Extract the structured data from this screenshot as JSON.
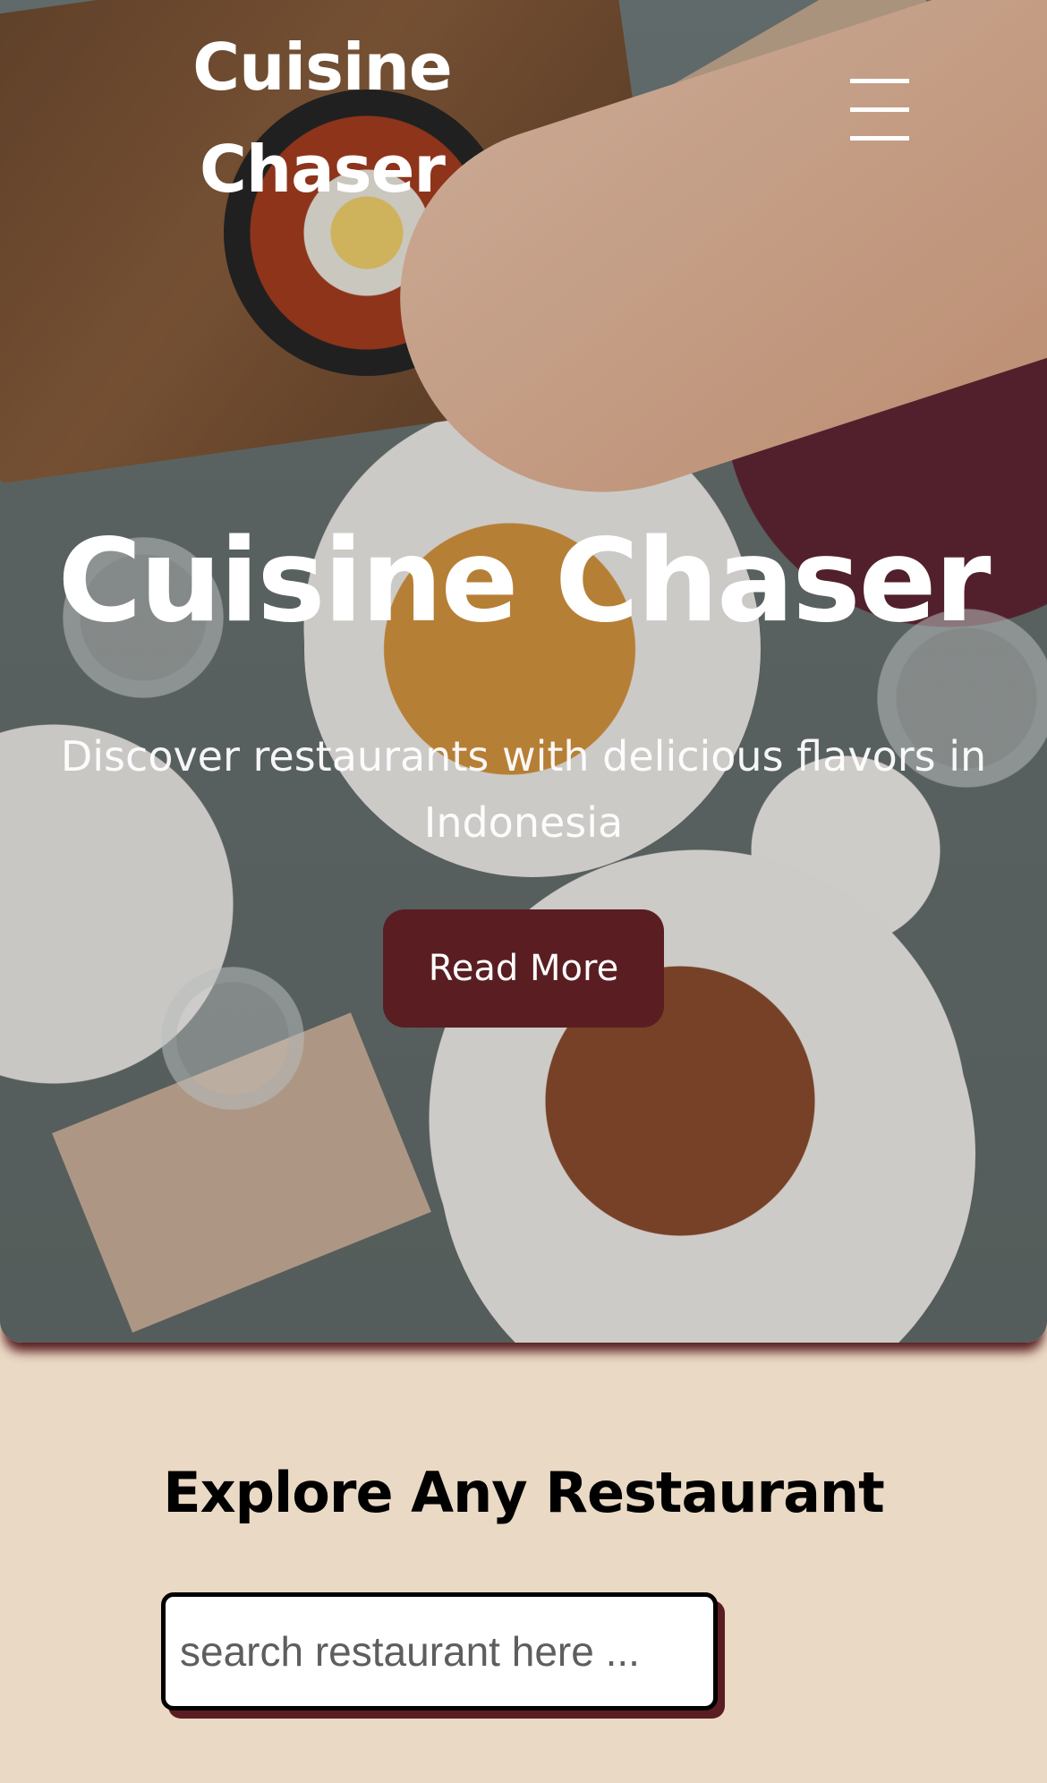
{
  "header": {
    "brand": "Cuisine Chaser",
    "menu_icon": "hamburger-menu-icon"
  },
  "hero": {
    "title": "Cuisine Chaser",
    "subtitle": "Discover restaurants with delicious flavors in Indonesia",
    "button_label": "Read More"
  },
  "explore": {
    "title": "Explore Any Restaurant",
    "search_placeholder": "search restaurant here ...",
    "search_value": ""
  },
  "colors": {
    "accent": "#5a1e22",
    "background": "#ead9c4",
    "text_light": "#ffffff",
    "text_dark": "#000000"
  }
}
